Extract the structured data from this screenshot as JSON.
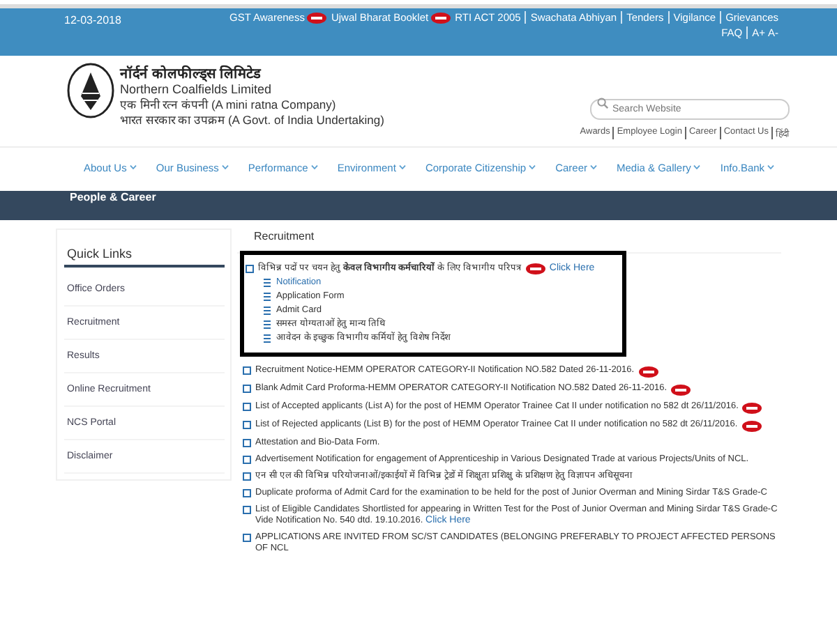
{
  "top_bar": {
    "date": "12-03-2018",
    "links": [
      {
        "label": "GST Awareness",
        "new": true
      },
      {
        "label": "Ujwal Bharat Booklet",
        "new": true
      },
      {
        "label": "RTI ACT 2005",
        "new": false
      },
      {
        "label": "Swachata Abhiyan",
        "new": false
      },
      {
        "label": "Tenders",
        "new": false
      },
      {
        "label": "Vigilance",
        "new": false
      },
      {
        "label": "Grievances",
        "new": false
      }
    ],
    "utility": [
      "FAQ",
      "A+",
      "A-"
    ]
  },
  "header": {
    "name_hindi": "नॉर्दर्न कोलफील्ड्स लिमिटेड",
    "name_english": "Northern Coalfields Limited",
    "tagline_1": "एक मिनी रत्न कंपनी (A mini ratna Company)",
    "tagline_2": "भारत सरकार का उपक्रम (A Govt. of India Undertaking)",
    "search": {
      "placeholder": "Search Website"
    },
    "links": [
      "Awards",
      "Employee Login",
      "Career",
      "Contact Us",
      "हिंदी"
    ]
  },
  "nav": [
    "About Us",
    "Our Business",
    "Performance",
    "Environment",
    "Corporate Citizenship",
    "Career",
    "Media & Gallery",
    "Info.Bank"
  ],
  "banner": {
    "title": "People & Career"
  },
  "sidebar": {
    "title": "Quick Links",
    "items": [
      "Office Orders",
      "Recruitment",
      "Results",
      "Online Recruitment",
      "NCS Portal",
      "Disclaimer"
    ]
  },
  "main": {
    "title": "Recruitment",
    "featured": {
      "text": "विभिन्न पदों पर चयन हेतु **केवल विभागीय कर्मचारियों** के लिए विभागीय परिपत्र",
      "new": true,
      "link": "Click Here",
      "children": [
        {
          "label": "Notification",
          "kind": "link"
        },
        {
          "label": "Application Form",
          "kind": "text"
        },
        {
          "label": "Admit Card",
          "kind": "text"
        },
        {
          "label": "समस्त योग्यताओं हेतु मान्य तिथि",
          "kind": "text"
        },
        {
          "label": "आवेदन के इच्छुक विभागीय कर्मियों हेतु विशेष निर्देश",
          "kind": "text"
        }
      ]
    },
    "notices": [
      {
        "text": "Recruitment Notice-HEMM OPERATOR CATEGORY-II Notification NO.582 Dated 26-11-2016.",
        "new": true
      },
      {
        "text": "Blank Admit Card Proforma-HEMM OPERATOR CATEGORY-II Notification NO.582 Dated 26-11-2016.",
        "new": true
      },
      {
        "text": "List of Accepted applicants (List A) for the post of HEMM Operator Trainee Cat II under notification no 582 dt 26/11/2016.",
        "new": true
      },
      {
        "text": "List of Rejected applicants (List B) for the post of HEMM Operator Trainee Cat II under notification no 582 dt 26/11/2016.",
        "new": true
      },
      {
        "text": "Attestation and Bio-Data Form.",
        "new": false
      },
      {
        "text": "Advertisement Notification for engagement of Apprenticeship in Various Designated Trade at various Projects/Units of NCL.",
        "new": false
      },
      {
        "text": "एन सी एल की विभिन्न परियोजनाओं/इकाईयों में विभिन्न ट्रेडों में शिक्षुता प्रशिक्षु के प्रशिक्षण हेतु विज्ञापन अधिसूचना",
        "new": false
      },
      {
        "text": "Duplicate proforma of Admit Card for the examination to be held for the post of Junior Overman and Mining Sirdar T&S Grade-C",
        "new": false
      },
      {
        "text": "List of Eligible Candidates Shortlisted for appearing in Written Test for the Post of Junior Overman and Mining Sirdar T&S Grade-C Vide Notification No. 540 dtd. 19.10.2016.",
        "new": false,
        "link": "Click Here"
      },
      {
        "text": "APPLICATIONS ARE INVITED FROM SC/ST CANDIDATES (BELONGING PREFERABLY TO PROJECT AFFECTED PERSONS OF NCL",
        "new": false
      }
    ]
  }
}
